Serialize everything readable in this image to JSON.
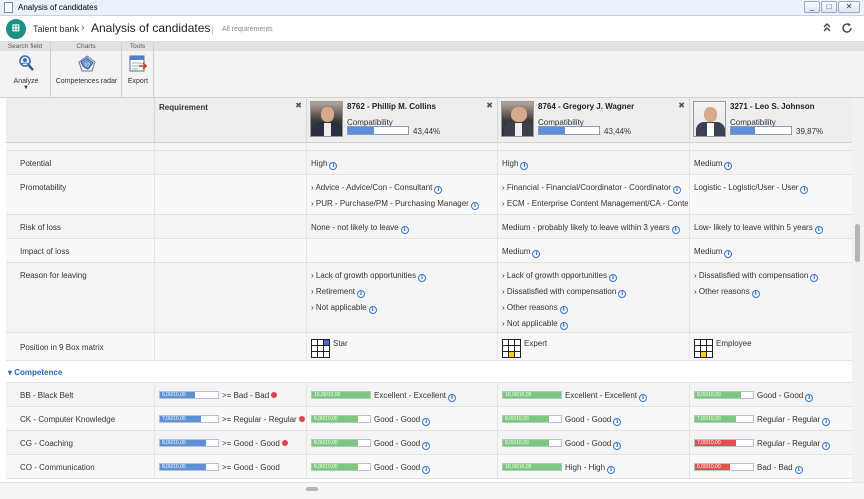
{
  "window": {
    "title": "Analysis of candidates",
    "controls": [
      "_",
      "□",
      "✕"
    ]
  },
  "header": {
    "logo_text": "⊞",
    "breadcrumb_root": "Talent bank",
    "separator": "›",
    "title": "Analysis of candidates",
    "subtitle": "All requirements",
    "collapse_icon": "chevron-up-double-icon",
    "refresh_icon": "refresh-icon"
  },
  "ribbon": {
    "groups": [
      {
        "label": "Search field",
        "button": "Analyze",
        "icon": "search-user-icon",
        "has_dropdown": true
      },
      {
        "label": "Charts",
        "button": "Competences radar",
        "icon": "radar-chart-icon"
      },
      {
        "label": "Tools",
        "button": "Export",
        "icon": "export-icon"
      }
    ]
  },
  "columns": {
    "requirement": {
      "label": "Requirement",
      "close": "✖"
    },
    "candidates": [
      {
        "name": "8762 - Phillip M. Collins",
        "compat_label": "Compatibility",
        "compat": 43.44,
        "compat_text": "43,44%",
        "close": "✖"
      },
      {
        "name": "8764 - Gregory J. Wagner",
        "compat_label": "Compatibility",
        "compat": 43.44,
        "compat_text": "43,44%",
        "close": "✖"
      },
      {
        "name": "3271 - Leo S. Johnson",
        "compat_label": "Compatibility",
        "compat": 39.87,
        "compat_text": "39,87%",
        "close": ""
      }
    ]
  },
  "rows": {
    "potential": {
      "label": "Potential",
      "values": [
        "High",
        "High",
        "Medium"
      ]
    },
    "promotability": {
      "label": "Promotability",
      "values": [
        [
          "› Advice - Advice/Con - Consultant",
          "› PUR - Purchase/PM - Purchasing Manager"
        ],
        [
          "› Financial - Financial/Coordinator - Coordinator",
          "› ECM - Enterprise Content Management/CA - Content Ar"
        ],
        [
          "Logistic - Logistic/User - User"
        ]
      ]
    },
    "risk": {
      "label": "Risk of loss",
      "values": [
        "None - not likely to leave",
        "Medium - probably likely to leave within 3 years",
        "Low- likely to leave within 5 years"
      ]
    },
    "impact": {
      "label": "Impact of loss",
      "values": [
        "",
        "Medium",
        "Medium"
      ]
    },
    "reason": {
      "label": "Reason for leaving",
      "values": [
        [
          "› Lack of growth opportunities",
          "› Retirement",
          "› Not applicable"
        ],
        [
          "› Lack of growth opportunities",
          "› Dissatisfied with compensation",
          "› Other reasons",
          "› Not applicable"
        ],
        [
          "› Dissatisfied with compensation",
          "› Other reasons"
        ]
      ]
    },
    "ninebox": {
      "label": "Position in 9 Box matrix",
      "values": [
        "Star",
        "Expert",
        "Employee"
      ]
    }
  },
  "competence": {
    "section_label": "Competence",
    "section_marker": "▾",
    "items": [
      {
        "label": "BB - Black Belt",
        "req": {
          "value": 6,
          "bar_text": "6,00/10,00",
          "text": ">= Bad - Bad",
          "mark": true
        },
        "cands": [
          {
            "value": 10,
            "bar_text": "10,00/10,00",
            "color": "green",
            "text": "Excellent - Excellent"
          },
          {
            "value": 10,
            "bar_text": "10,00/10,00",
            "color": "green",
            "text": "Excellent - Excellent"
          },
          {
            "value": 8,
            "bar_text": "8,00/10,00",
            "color": "green",
            "text": "Good - Good"
          }
        ]
      },
      {
        "label": "CK - Computer Knowledge",
        "req": {
          "value": 7,
          "bar_text": "7,00/10,00",
          "text": ">= Regular - Regular",
          "mark": true
        },
        "cands": [
          {
            "value": 8,
            "bar_text": "8,00/10,00",
            "color": "green",
            "text": "Good - Good"
          },
          {
            "value": 8,
            "bar_text": "8,00/10,00",
            "color": "green",
            "text": "Good - Good"
          },
          {
            "value": 7,
            "bar_text": "7,00/10,00",
            "color": "green",
            "text": "Regular - Regular"
          }
        ]
      },
      {
        "label": "CG - Coaching",
        "req": {
          "value": 8,
          "bar_text": "8,00/10,00",
          "text": ">= Good - Good",
          "mark": true
        },
        "cands": [
          {
            "value": 8,
            "bar_text": "8,00/10,00",
            "color": "green",
            "text": "Good - Good"
          },
          {
            "value": 8,
            "bar_text": "8,00/10,00",
            "color": "green",
            "text": "Good - Good"
          },
          {
            "value": 7,
            "bar_text": "7,00/10,00",
            "color": "red",
            "text": "Regular - Regular"
          }
        ]
      },
      {
        "label": "CO - Communication",
        "req": {
          "value": 8,
          "bar_text": "8,00/10,00",
          "text": ">= Good - Good",
          "mark": false
        },
        "cands": [
          {
            "value": 8,
            "bar_text": "8,00/10,00",
            "color": "green",
            "text": "Good - Good"
          },
          {
            "value": 10,
            "bar_text": "10,00/10,00",
            "color": "green",
            "text": "High - High"
          },
          {
            "value": 6,
            "bar_text": "6,00/10,00",
            "color": "red",
            "text": "Bad - Bad"
          }
        ]
      }
    ]
  },
  "colors": {
    "accent": "#1f8f8b",
    "link": "#2a64b7",
    "bar_blue": "#5f8fd6",
    "bar_green": "#7cc87c",
    "bar_red": "#d9534f"
  }
}
